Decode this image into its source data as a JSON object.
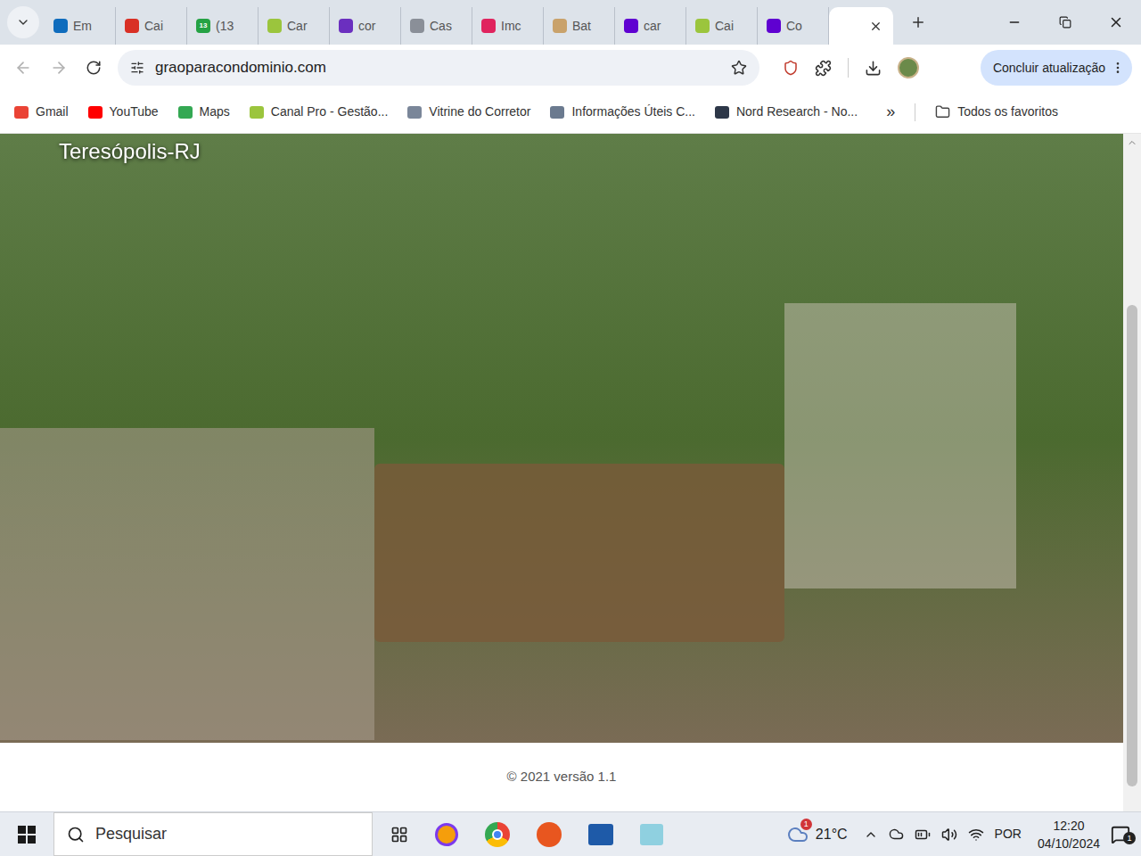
{
  "browser": {
    "tabs": [
      {
        "label": "Em",
        "selected": false,
        "color": "#0f6cbd",
        "badge": ""
      },
      {
        "label": "Cai",
        "selected": false,
        "color": "#d93025",
        "badge": ""
      },
      {
        "label": "(13",
        "selected": false,
        "color": "#25a244",
        "badge": "13"
      },
      {
        "label": "Car",
        "selected": false,
        "color": "#9bc53d",
        "badge": ""
      },
      {
        "label": "cor",
        "selected": false,
        "color": "#6b2fbf",
        "badge": ""
      },
      {
        "label": "Cas",
        "selected": false,
        "color": "#8a8f98",
        "badge": ""
      },
      {
        "label": "Imc",
        "selected": false,
        "color": "#e0245e",
        "badge": ""
      },
      {
        "label": "Bat",
        "selected": false,
        "color": "#c9a26b",
        "badge": ""
      },
      {
        "label": "car",
        "selected": false,
        "color": "#5f01d1",
        "badge": ""
      },
      {
        "label": "Cai",
        "selected": false,
        "color": "#9bc53d",
        "badge": ""
      },
      {
        "label": "Co",
        "selected": false,
        "color": "#5f01d1",
        "badge": ""
      },
      {
        "label": "",
        "selected": true,
        "color": "#ffffff",
        "badge": ""
      }
    ],
    "address": "graoparacondominio.com",
    "update_button": "Concluir atualização",
    "bookmarks": [
      {
        "label": "Gmail",
        "color": "#ea4335"
      },
      {
        "label": "YouTube",
        "color": "#ff0000"
      },
      {
        "label": "Maps",
        "color": "#34a853"
      },
      {
        "label": "Canal Pro - Gestão...",
        "color": "#9bc53d"
      },
      {
        "label": "Vitrine do Corretor",
        "color": "#7a8699"
      },
      {
        "label": "Informações Úteis C...",
        "color": "#6b7a8f"
      },
      {
        "label": "Nord Research - No...",
        "color": "#2d3748"
      }
    ],
    "bookmarks_overflow": "»",
    "all_bookmarks": "Todos os favoritos"
  },
  "page": {
    "location": "Teresópolis-RJ",
    "footer": "© 2021 versão 1.1"
  },
  "taskbar": {
    "search_placeholder": "Pesquisar",
    "weather": {
      "temp": "21°C",
      "badge": "1"
    },
    "language": "POR",
    "time": "12:20",
    "date": "04/10/2024",
    "notifications": "1"
  }
}
